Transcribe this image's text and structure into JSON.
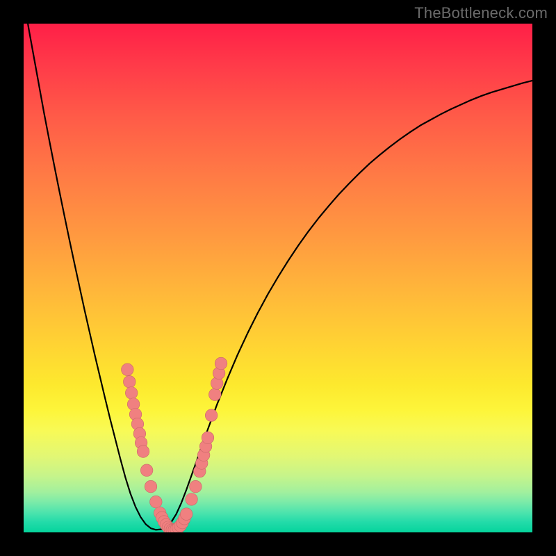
{
  "watermark": "TheBottleneck.com",
  "colors": {
    "frame": "#000000",
    "curve": "#000000",
    "marker_fill": "#f08080",
    "marker_stroke": "#c86868"
  },
  "chart_data": {
    "type": "line",
    "title": "",
    "xlabel": "",
    "ylabel": "",
    "xlim": [
      0,
      100
    ],
    "ylim": [
      0,
      100
    ],
    "x": [
      0,
      1,
      2,
      3,
      4,
      5,
      6,
      7,
      8,
      9,
      10,
      11,
      12,
      13,
      14,
      15,
      16,
      17,
      18,
      19,
      20,
      21,
      22,
      23,
      24,
      25,
      26,
      27,
      28,
      29,
      30,
      31,
      32,
      33,
      34,
      35,
      36,
      37,
      38,
      39,
      40,
      42,
      44,
      46,
      48,
      50,
      52,
      54,
      56,
      58,
      60,
      62,
      64,
      66,
      68,
      70,
      72,
      74,
      76,
      78,
      80,
      82,
      84,
      86,
      88,
      90,
      92,
      94,
      96,
      98,
      100
    ],
    "values": [
      105,
      99,
      93.5,
      88,
      82.5,
      77.3,
      72.2,
      67.2,
      62.3,
      57.5,
      52.8,
      48.2,
      43.6,
      39.2,
      34.8,
      30.6,
      26.4,
      22.3,
      18.4,
      14.5,
      10.8,
      7.6,
      5.0,
      3.0,
      1.6,
      0.8,
      0.5,
      0.6,
      1.1,
      2.0,
      3.6,
      5.8,
      8.4,
      11.2,
      14.0,
      16.9,
      19.7,
      22.4,
      25.1,
      27.6,
      30.1,
      34.8,
      39.1,
      43.1,
      46.8,
      50.2,
      53.4,
      56.4,
      59.2,
      61.8,
      64.2,
      66.5,
      68.6,
      70.6,
      72.5,
      74.2,
      75.8,
      77.3,
      78.7,
      80.0,
      81.1,
      82.2,
      83.2,
      84.1,
      85.0,
      85.8,
      86.5,
      87.1,
      87.7,
      88.3,
      88.8
    ],
    "markers": [
      {
        "x": 20.4,
        "y": 32.0
      },
      {
        "x": 20.8,
        "y": 29.6
      },
      {
        "x": 21.2,
        "y": 27.4
      },
      {
        "x": 21.6,
        "y": 25.2
      },
      {
        "x": 22.0,
        "y": 23.2
      },
      {
        "x": 22.4,
        "y": 21.3
      },
      {
        "x": 22.8,
        "y": 19.4
      },
      {
        "x": 23.1,
        "y": 17.6
      },
      {
        "x": 23.5,
        "y": 15.9
      },
      {
        "x": 24.2,
        "y": 12.2
      },
      {
        "x": 25.0,
        "y": 9.0
      },
      {
        "x": 26.0,
        "y": 6.0
      },
      {
        "x": 26.8,
        "y": 3.8
      },
      {
        "x": 27.2,
        "y": 2.9
      },
      {
        "x": 27.6,
        "y": 2.1
      },
      {
        "x": 28.0,
        "y": 1.5
      },
      {
        "x": 28.4,
        "y": 1.0
      },
      {
        "x": 28.8,
        "y": 0.7
      },
      {
        "x": 29.2,
        "y": 0.5
      },
      {
        "x": 29.6,
        "y": 0.5
      },
      {
        "x": 30.0,
        "y": 0.6
      },
      {
        "x": 30.4,
        "y": 0.9
      },
      {
        "x": 30.8,
        "y": 1.3
      },
      {
        "x": 31.2,
        "y": 1.9
      },
      {
        "x": 31.6,
        "y": 2.7
      },
      {
        "x": 32.0,
        "y": 3.6
      },
      {
        "x": 33.0,
        "y": 6.5
      },
      {
        "x": 33.8,
        "y": 9.0
      },
      {
        "x": 34.6,
        "y": 12.0
      },
      {
        "x": 35.0,
        "y": 13.6
      },
      {
        "x": 35.4,
        "y": 15.2
      },
      {
        "x": 35.8,
        "y": 16.9
      },
      {
        "x": 36.2,
        "y": 18.6
      },
      {
        "x": 36.9,
        "y": 23.0
      },
      {
        "x": 37.6,
        "y": 27.1
      },
      {
        "x": 38.0,
        "y": 29.3
      },
      {
        "x": 38.4,
        "y": 31.3
      },
      {
        "x": 38.8,
        "y": 33.2
      }
    ],
    "marker_radius_px": 8.8
  }
}
